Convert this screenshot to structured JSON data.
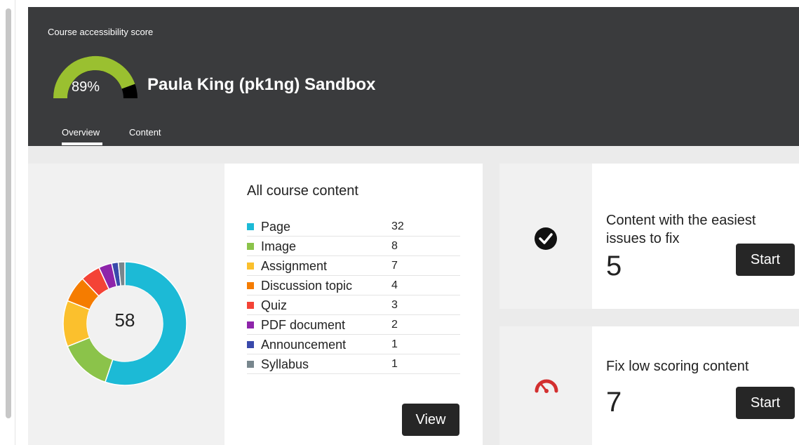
{
  "header": {
    "score_caption": "Course accessibility score",
    "score_value": "89%",
    "score_fraction": 0.89,
    "course_title": "Paula King (pk1ng) Sandbox",
    "tabs": [
      {
        "label": "Overview",
        "active": true
      },
      {
        "label": "Content",
        "active": false
      }
    ],
    "gauge_color": "#9ac030"
  },
  "content_summary": {
    "total": "58",
    "title": "All course content",
    "items": [
      {
        "label": "Page",
        "count": "32",
        "color": "#1cbad6"
      },
      {
        "label": "Image",
        "count": "8",
        "color": "#8bc34a"
      },
      {
        "label": "Assignment",
        "count": "7",
        "color": "#fbc02d"
      },
      {
        "label": "Discussion topic",
        "count": "4",
        "color": "#f57c00"
      },
      {
        "label": "Quiz",
        "count": "3",
        "color": "#f44336"
      },
      {
        "label": "PDF document",
        "count": "2",
        "color": "#8e24aa"
      },
      {
        "label": "Announcement",
        "count": "1",
        "color": "#3949ab"
      },
      {
        "label": "Syllabus",
        "count": "1",
        "color": "#78868d"
      }
    ],
    "view_label": "View"
  },
  "cards": {
    "easy": {
      "title": "Content with the easiest issues to fix",
      "count": "5",
      "button": "Start",
      "icon": "check-circle-icon"
    },
    "low": {
      "title": "Fix low scoring content",
      "count": "7",
      "button": "Start",
      "icon": "speedometer-icon",
      "icon_color": "#d32f2f"
    }
  }
}
